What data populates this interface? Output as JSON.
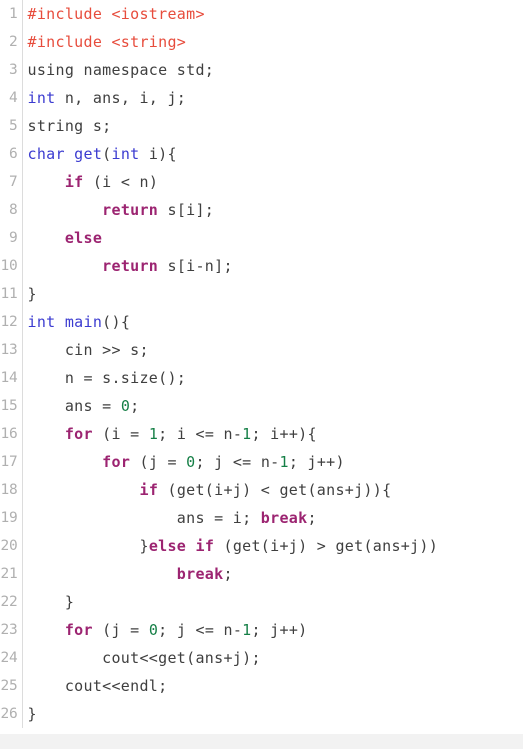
{
  "editor": {
    "language": "C++",
    "first_line_number": 1,
    "last_line_number": 26,
    "total_lines": 26,
    "gutter_separator_color": "#dcdcdc",
    "background_color": "#ffffff",
    "footer_color": "#f2f2f2"
  },
  "theme": {
    "preprocessor_color": "#e74c3c",
    "keyword_color": "#9c2471",
    "type_color": "#3b3bd0",
    "function_color": "#3b3bd0",
    "number_color": "#157f46",
    "plain_color": "#3f3f3f",
    "line_number_color": "#b0b0b0"
  },
  "lines": [
    {
      "number": "1",
      "tokens": [
        {
          "t": "#include <iostream>",
          "c": "pre"
        }
      ]
    },
    {
      "number": "2",
      "tokens": [
        {
          "t": "#include <string>",
          "c": "pre"
        }
      ]
    },
    {
      "number": "3",
      "tokens": [
        {
          "t": "using namespace std;",
          "c": "plain"
        }
      ]
    },
    {
      "number": "4",
      "tokens": [
        {
          "t": "int",
          "c": "type"
        },
        {
          "t": " n, ans, i, j;",
          "c": "plain"
        }
      ]
    },
    {
      "number": "5",
      "tokens": [
        {
          "t": "string s;",
          "c": "plain"
        }
      ]
    },
    {
      "number": "6",
      "tokens": [
        {
          "t": "char",
          "c": "type"
        },
        {
          "t": " ",
          "c": "plain"
        },
        {
          "t": "get",
          "c": "fn"
        },
        {
          "t": "(",
          "c": "plain"
        },
        {
          "t": "int",
          "c": "type"
        },
        {
          "t": " i){",
          "c": "plain"
        }
      ]
    },
    {
      "number": "7",
      "tokens": [
        {
          "t": "    ",
          "c": "plain"
        },
        {
          "t": "if",
          "c": "kw"
        },
        {
          "t": " (i < n)",
          "c": "plain"
        }
      ]
    },
    {
      "number": "8",
      "tokens": [
        {
          "t": "        ",
          "c": "plain"
        },
        {
          "t": "return",
          "c": "kw"
        },
        {
          "t": " s[i];",
          "c": "plain"
        }
      ]
    },
    {
      "number": "9",
      "tokens": [
        {
          "t": "    ",
          "c": "plain"
        },
        {
          "t": "else",
          "c": "kw"
        }
      ]
    },
    {
      "number": "10",
      "tokens": [
        {
          "t": "        ",
          "c": "plain"
        },
        {
          "t": "return",
          "c": "kw"
        },
        {
          "t": " s[i-n];",
          "c": "plain"
        }
      ]
    },
    {
      "number": "11",
      "tokens": [
        {
          "t": "}",
          "c": "plain"
        }
      ]
    },
    {
      "number": "12",
      "tokens": [
        {
          "t": "int",
          "c": "type"
        },
        {
          "t": " ",
          "c": "plain"
        },
        {
          "t": "main",
          "c": "fn"
        },
        {
          "t": "(){",
          "c": "plain"
        }
      ]
    },
    {
      "number": "13",
      "tokens": [
        {
          "t": "    cin >> s;",
          "c": "plain"
        }
      ]
    },
    {
      "number": "14",
      "tokens": [
        {
          "t": "    n = s.size();",
          "c": "plain"
        }
      ]
    },
    {
      "number": "15",
      "tokens": [
        {
          "t": "    ans = ",
          "c": "plain"
        },
        {
          "t": "0",
          "c": "num"
        },
        {
          "t": ";",
          "c": "plain"
        }
      ]
    },
    {
      "number": "16",
      "tokens": [
        {
          "t": "    ",
          "c": "plain"
        },
        {
          "t": "for",
          "c": "kw"
        },
        {
          "t": " (i = ",
          "c": "plain"
        },
        {
          "t": "1",
          "c": "num"
        },
        {
          "t": "; i <= n-",
          "c": "plain"
        },
        {
          "t": "1",
          "c": "num"
        },
        {
          "t": "; i++){",
          "c": "plain"
        }
      ]
    },
    {
      "number": "17",
      "tokens": [
        {
          "t": "        ",
          "c": "plain"
        },
        {
          "t": "for",
          "c": "kw"
        },
        {
          "t": " (j = ",
          "c": "plain"
        },
        {
          "t": "0",
          "c": "num"
        },
        {
          "t": "; j <= n-",
          "c": "plain"
        },
        {
          "t": "1",
          "c": "num"
        },
        {
          "t": "; j++)",
          "c": "plain"
        }
      ]
    },
    {
      "number": "18",
      "tokens": [
        {
          "t": "            ",
          "c": "plain"
        },
        {
          "t": "if",
          "c": "kw"
        },
        {
          "t": " (get(i+j) < get(ans+j)){",
          "c": "plain"
        }
      ]
    },
    {
      "number": "19",
      "tokens": [
        {
          "t": "                ans = i; ",
          "c": "plain"
        },
        {
          "t": "break",
          "c": "kw"
        },
        {
          "t": ";",
          "c": "plain"
        }
      ]
    },
    {
      "number": "20",
      "tokens": [
        {
          "t": "            }",
          "c": "plain"
        },
        {
          "t": "else",
          "c": "kw"
        },
        {
          "t": " ",
          "c": "plain"
        },
        {
          "t": "if",
          "c": "kw"
        },
        {
          "t": " (get(i+j) > get(ans+j))",
          "c": "plain"
        }
      ]
    },
    {
      "number": "21",
      "tokens": [
        {
          "t": "                ",
          "c": "plain"
        },
        {
          "t": "break",
          "c": "kw"
        },
        {
          "t": ";",
          "c": "plain"
        }
      ]
    },
    {
      "number": "22",
      "tokens": [
        {
          "t": "    }",
          "c": "plain"
        }
      ]
    },
    {
      "number": "23",
      "tokens": [
        {
          "t": "    ",
          "c": "plain"
        },
        {
          "t": "for",
          "c": "kw"
        },
        {
          "t": " (j = ",
          "c": "plain"
        },
        {
          "t": "0",
          "c": "num"
        },
        {
          "t": "; j <= n-",
          "c": "plain"
        },
        {
          "t": "1",
          "c": "num"
        },
        {
          "t": "; j++)",
          "c": "plain"
        }
      ]
    },
    {
      "number": "24",
      "tokens": [
        {
          "t": "        cout<<get(ans+j);",
          "c": "plain"
        }
      ]
    },
    {
      "number": "25",
      "tokens": [
        {
          "t": "    cout<<endl;",
          "c": "plain"
        }
      ]
    },
    {
      "number": "26",
      "tokens": [
        {
          "t": "}",
          "c": "plain"
        }
      ]
    }
  ]
}
